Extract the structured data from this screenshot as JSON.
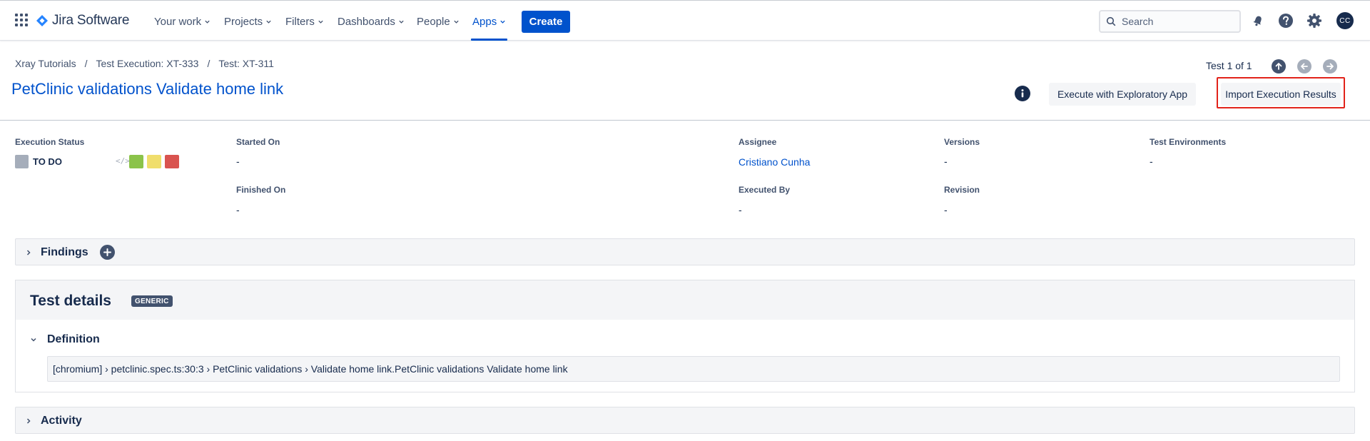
{
  "nav": {
    "product": "Jira Software",
    "items": [
      {
        "label": "Your work"
      },
      {
        "label": "Projects"
      },
      {
        "label": "Filters"
      },
      {
        "label": "Dashboards"
      },
      {
        "label": "People"
      },
      {
        "label": "Apps"
      }
    ],
    "active_item": "Apps",
    "create_label": "Create",
    "search_placeholder": "Search",
    "avatar_initials": "CC",
    "accent_color": "#0052cc"
  },
  "breadcrumb": [
    "Xray Tutorials",
    "Test Execution: XT-333",
    "Test: XT-311"
  ],
  "page_title": "PetClinic validations Validate home link",
  "pager": {
    "text": "Test 1 of 1"
  },
  "actions": {
    "execute_exploratory": "Execute with Exploratory App",
    "import_results": "Import Execution Results"
  },
  "fields": {
    "execution_status": {
      "label": "Execution Status",
      "value": "TO DO",
      "code_icon": "</>"
    },
    "started_on": {
      "label": "Started On",
      "value": "-"
    },
    "finished_on": {
      "label": "Finished On",
      "value": "-"
    },
    "assignee": {
      "label": "Assignee",
      "value": "Cristiano Cunha"
    },
    "executed_by": {
      "label": "Executed By",
      "value": "-"
    },
    "versions": {
      "label": "Versions",
      "value": "-"
    },
    "revision": {
      "label": "Revision",
      "value": "-"
    },
    "test_environments": {
      "label": "Test Environments",
      "value": "-"
    }
  },
  "status_colors": {
    "todo": "#a5adba",
    "pass": "#8bc34a",
    "executing": "#f0de6c",
    "fail": "#d9534f"
  },
  "findings": {
    "title": "Findings"
  },
  "test_details": {
    "title": "Test details",
    "badge": "GENERIC",
    "definition_title": "Definition",
    "definition_text": "[chromium] › petclinic.spec.ts:30:3 › PetClinic validations › Validate home link.PetClinic validations Validate home link"
  },
  "activity": {
    "title": "Activity"
  }
}
